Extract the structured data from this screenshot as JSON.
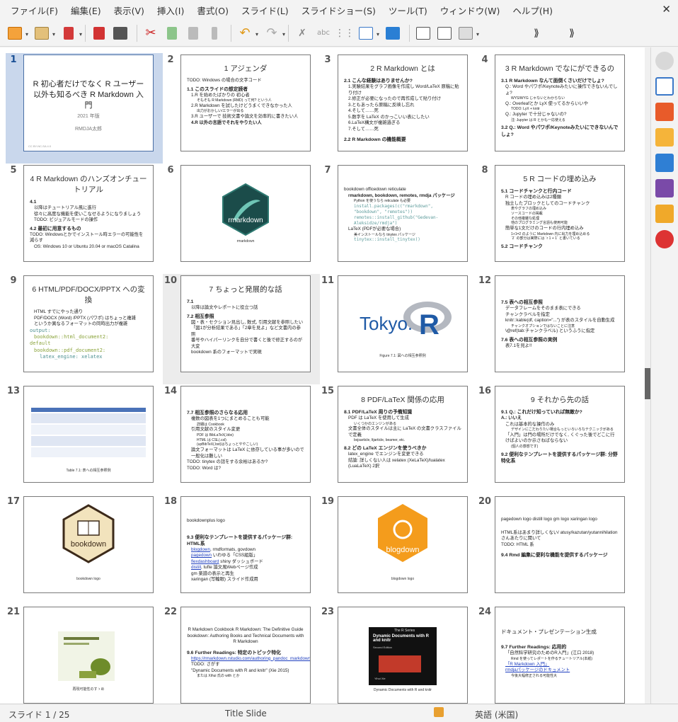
{
  "menu": [
    "ファイル(F)",
    "編集(E)",
    "表示(V)",
    "挿入(I)",
    "書式(O)",
    "スライド(L)",
    "スライドショー(S)",
    "ツール(T)",
    "ウィンドウ(W)",
    "ヘルプ(H)"
  ],
  "status": {
    "slide": "スライド 1 / 25",
    "layout": "Title Slide",
    "lang": "英語 (米国)"
  },
  "nums": [
    "1",
    "2",
    "3",
    "4",
    "5",
    "6",
    "7",
    "8",
    "9",
    "10",
    "11",
    "12",
    "13",
    "14",
    "15",
    "16",
    "17",
    "18",
    "19",
    "20",
    "21",
    "22",
    "23",
    "24"
  ],
  "s1": {
    "title": "R 初心者だけでなく R ユーザー以外も知るべき R Markdown 入門",
    "year": "2021 年版",
    "author": "RMDJA太郎",
    "foot": "CC BY-NC-SA 4.0"
  },
  "s2": {
    "title": "1 アジェンダ",
    "todo": "TODO: Windows の場合の文字コード",
    "h1": "1.1 このスライドの想定読者",
    "l1": "1.R を始めたばかりの 初心者",
    "l1a": "そもそも R Markdown (RMD) って何? という人",
    "l2": "2.R Markdown を試したけどうまくできなかった人",
    "l2a": "出力がおかしい/エラーが出る",
    "l3": "3.R ユーザーで 技術文書や論文を効率的に書きたい人",
    "l4": "4.R 以外の言語でそれをやりたい人"
  },
  "s3": {
    "title": "2 R Markdown とは",
    "h1": "2.1 こんな経験はありませんか?",
    "l1": "1.実験結果をグラフ画像を作成し Word/LaTeX 原稿に貼り付け",
    "l2": "2.修正が必要になったので再作成して貼り付け",
    "l3": "3.ともあったら原稿に反映し忘れ",
    "l4": "4.そして……死",
    "l5": "5.数字を LaTeX のかっこいい表にしたい",
    "l6": "6.LaTeX構文が複雑過ぎる",
    "l7": "7.そして……死",
    "h2": "2.2 R Markdown の機能概要"
  },
  "s4": {
    "title": "3 R Markdown でなにができるの",
    "h1": "3.1 R Markdown なんて面倒くさいだけでしょ?",
    "l1": "Q.: Word やパワポ/Keynoteみたいに操作できないんでしょ?",
    "l1a": "WYSIWYG じゃないとわからない",
    "l2": "Q.: Overleafとか LyX 使ってるからいいや",
    "l2a": "TODO: LyX + knitr",
    "l3": "Q.: Jupyter で十分じゃないの?",
    "l3a": "注: Jupyter は R とかも一応使える",
    "h2": "3.2 Q.: Word やパワポ/Keynoteみたいにできないんでしょ?"
  },
  "s5": {
    "title": "4 R Markdown のハンズオンチュートリアル",
    "h1": "4.1",
    "l1": "以降はチュートリアル風に進行",
    "l2": "徐々に高度な機能を使いこなせるようになりましょう",
    "l3": "TODO: ビジュアルモードの操作",
    "h2": "4.2 最初に用意するもの",
    "l4": "TODO: Windowsとかでインストール時エラーの可能性を減らす",
    "l5": "OS: Windows 10 or Ubuntu 20.04 or macOS Catalina"
  },
  "s6": {
    "logo": "rmarkdown",
    "cap": "rmarkdown"
  },
  "s7": {
    "l0": "bookdown officedown reticulate",
    "l1": "rmarkdown, bookdown, remotes, rmdja パッケージ",
    "l1a": "Python を使うなら reticulate も必要",
    "c1": "install.packages(c(\"rmarkdown\", \"bookdown\", \"remotes\"))",
    "c2": "remotes::install_github(\"Gedevan-Aleksidze/rmdja\")",
    "l2": "LaTeX (PDFが必要な場合)",
    "l2a": "美インストールなら tinytex パッケージ",
    "c3": "tinytex::install_tinytex()"
  },
  "s8": {
    "title": "5 R コードの埋め込み",
    "h1": "5.1 コードチャンクと行内コード",
    "l1": "R コードの埋め込みは2種類",
    "l2": "独立したブロックとしてのコードチャンク",
    "l2a": "表やグラフの埋め込み",
    "l2b": "ソースコードの掲載",
    "l2c": "その他複雑な処理",
    "l2d": "他のプログラミング言語も使用可能",
    "l3": "簡単な1文だけのコードの行内埋め込み",
    "l3a": "1+1=2 のように Markdown 内に出力を埋め込める",
    "l3b": "`2` の部分は実際には `r 1 + 1` と書いている",
    "h2": "5.2 コードチャンク"
  },
  "s9": {
    "title": "6 HTML/PDF/DOCX/PPTX への変換",
    "l1": "HTML すでにやった通り",
    "l2": "PDF/DOCX (Word) /PPTX (パワポ) はちょっと複雑",
    "l3": "というか異なるフォーマットの同時出力が複雑",
    "c1": "output:",
    "c2": "bookdown::html_document2:",
    "c3": "default",
    "c4": "bookdown::pdf_document2:",
    "c5": "latex_engine: xelatex"
  },
  "s10": {
    "title": "7 ちょっと発展的な話",
    "h1": "7.1",
    "l1": "以降は論文やレポートに役立つ話",
    "h2": "7.2 相互参照",
    "l2": "図・表・セクション見出し, 数式, 引用文献を参照したい",
    "l3": "「図1が分析結果である」「2章を見よ」など文書内の参照",
    "l4": "番号やハイパーリンクを自分で書くと後で修正するのが大変",
    "l5": "bookdown 系のフォーマットで実現"
  },
  "s11": {
    "logo1": "Tokyo.",
    "logo2": "R",
    "cap": "Figure 7.1: 図への相互参照例"
  },
  "s12": {
    "h1": "7.5 表への相互参照",
    "l1": "データフレームをそのまま表にできる",
    "l2": "チャンクラベルを指定",
    "l3": "knitr::kable(df, caption=\"...\") が表のスタイルを自動生成",
    "l3a": "チャンクオプションではないことに注意",
    "l4": "\\@ref(tab:チャンクラベル) というふうに指定",
    "h2": "7.6 表への相互参照の実例",
    "l5": "表7.1を見よ!!"
  },
  "s13": {
    "cap": "Table 7.1: 表への相互参照例"
  },
  "s14": {
    "h1": "7.7 相互参照のさらなる応用",
    "l1": "複数の図表を1つにまとめることも可能",
    "l1a": "詳細は Cookbook",
    "l2": "引用文献のスタイル変更",
    "l2a": "PDF は BibLaTeX(.bbx)",
    "l2b": "HTML は CSL(.csl)",
    "l2c": "(upBibTeX(.bst)はちょっとややこしい)",
    "l3": "論文フォーマットは LaTeX に依存している事が多いので一般化は難しい",
    "l4": "TODO: tinytex の話をする余裕はあるか?",
    "l5": "TODO: Word は?"
  },
  "s15": {
    "title": "8 PDF/LaTeX 関係の応用",
    "h1": "8.1 PDF/LaTeX 周りの予備知識",
    "l1": "PDF は LaTeX を使用して生成",
    "l1a": "いくつかのエンジンがある",
    "l2": "文書全体のスタイルは主に LaTeX の文書クラスファイルで定義",
    "l2a": "bxjsarticle, ltjarticle, beamer, etc.",
    "h2": "8.2 どの LaTeX エンジンを使うべきか",
    "l3": "latex_engine でエンジンを変更できる",
    "l4": "結論: 詳しくない人は xelatex (XeLaTeX)/lualatex (LuaLaTeX) 2択"
  },
  "s16": {
    "title": "9 それから先の話",
    "h1": "9.1 Q.: これだけ知っていれば無敵か?",
    "a": "A.: いいえ",
    "l1": "これは基本的な操作のみ",
    "l1a": "デザインにこだわりたい場合もっといろいろなテクニックがある",
    "l2": "「入門」は門の場所だけでなく, くぐった後でどこに行けばよいのか示さねばならない",
    "l2a": "(個人の感想です)",
    "h2": "9.2 便利なテンプレートを提供するパッケージ群: 分野特化系"
  },
  "s17": {
    "logo": "bookdown",
    "cap": "bookdown logo"
  },
  "s18": {
    "l0": "bookdownplus logo",
    "h1": "9.3 便利なテンプレートを提供するパッケージ群: HTML系",
    "l1a": "blogdown",
    "l1b": ", rmdformats, govdown",
    "l2a": "pagedown",
    "l2b": " いわゆる「CSS組版」",
    "l3a": "flexdashboard",
    "l3b": " shiny ダッシュボード",
    "l4a": "distill",
    "l4b": ", tufte 論文風Webページ作成",
    "l5": "gm 楽譜の表示と再生",
    "l6": "xaringan (写輪眼) スライド作成用"
  },
  "s19": {
    "logo": "blogdown",
    "cap": "blogdown logo"
  },
  "s20": {
    "l0": "pagedown logo distill logo gm logo xaringan logo",
    "l1": "HTML系はあまり詳しくない/ atusy/kazutan/yutannihilation さんあたりに聞いて",
    "l2": "TODO: HTML 系",
    "h1": "9.4 Rmd 編集に便利な機能を提供するパッケージ"
  },
  "s21": {
    "cap": "再現可能性のすゝめ"
  },
  "s22": {
    "l0": "R Markdown Cookbook R Markdown: The Definitive Guide bookdown: Authoring Books and Technical Documents with R Markdown",
    "h1": "9.6 Further Readings: 特定のトピック特化",
    "l1": "https://rmarkdown.rstudio.com/authoring_pandoc_markdown.html",
    "l2": "TODO: さがす",
    "l3": "\"Dynamic Documents with R and knitr\" (Xie 2015)",
    "l3a": "または Xihui 氏の with とか"
  },
  "s23": {
    "series": "The R Series",
    "book": "Dynamic Documents with R and knitr",
    "ed": "Second Edition",
    "author": "Yihui Xie",
    "cap": "Dynamic Documents with R and knitr"
  },
  "s24": {
    "l0": "ドキュメント・プレゼンテーション生成",
    "h1": "9.7 Further Readings: 応用的",
    "l1": "「自然科学研究のためのR入門」(江口 2018)",
    "l1a": "Rmd を使ってレポートを作るチュートリアル(本紙)",
    "l2": "「R Markdown 入門」",
    "l3": "rmdjaパッケージのドキュメント",
    "l3a": "今後大幅修正される可能性大"
  },
  "icons": {
    "toolbar": [
      "new-slide",
      "open-folder",
      "save",
      "export-pdf",
      "print",
      "cut",
      "copy",
      "paste",
      "clone-format",
      "undo",
      "redo",
      "spelling",
      "autospell",
      "grid",
      "layout",
      "display",
      "start-first",
      "start-current",
      "table",
      "more"
    ],
    "sidebar": [
      "properties",
      "slide-transition",
      "animation",
      "gallery",
      "navigator",
      "styles",
      "master"
    ]
  }
}
